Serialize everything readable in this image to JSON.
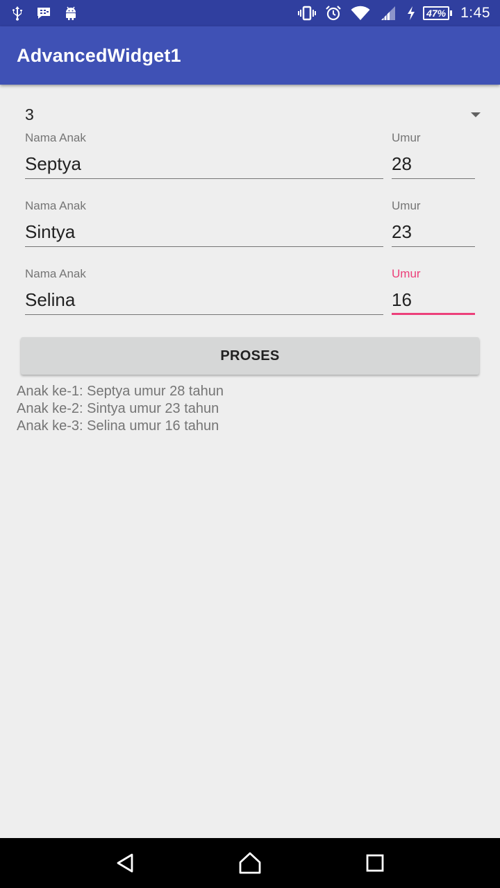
{
  "status_bar": {
    "battery_percent": "47%",
    "time": "1:45",
    "icons_left": [
      "usb-icon",
      "bbm-icon",
      "android-icon"
    ],
    "icons_right": [
      "vibrate-icon",
      "alarm-icon",
      "wifi-icon",
      "signal-icon",
      "charging-icon",
      "battery-icon"
    ]
  },
  "app_bar": {
    "title": "AdvancedWidget1"
  },
  "spinner": {
    "selected": "3"
  },
  "children": [
    {
      "name_label": "Nama Anak",
      "name_value": "Septya",
      "age_label": "Umur",
      "age_value": "28"
    },
    {
      "name_label": "Nama Anak",
      "name_value": "Sintya",
      "age_label": "Umur",
      "age_value": "23"
    },
    {
      "name_label": "Nama Anak",
      "name_value": "Selina",
      "age_label": "Umur",
      "age_value": "16"
    }
  ],
  "button": {
    "label": "PROSES"
  },
  "result": [
    "Anak ke-1: Septya umur 28 tahun",
    "Anak ke-2: Sintya umur 23 tahun",
    "Anak ke-3: Selina umur 16 tahun"
  ],
  "colors": {
    "primary": "#3f51b5",
    "primary_dark": "#303f9f",
    "accent": "#ec407a"
  }
}
